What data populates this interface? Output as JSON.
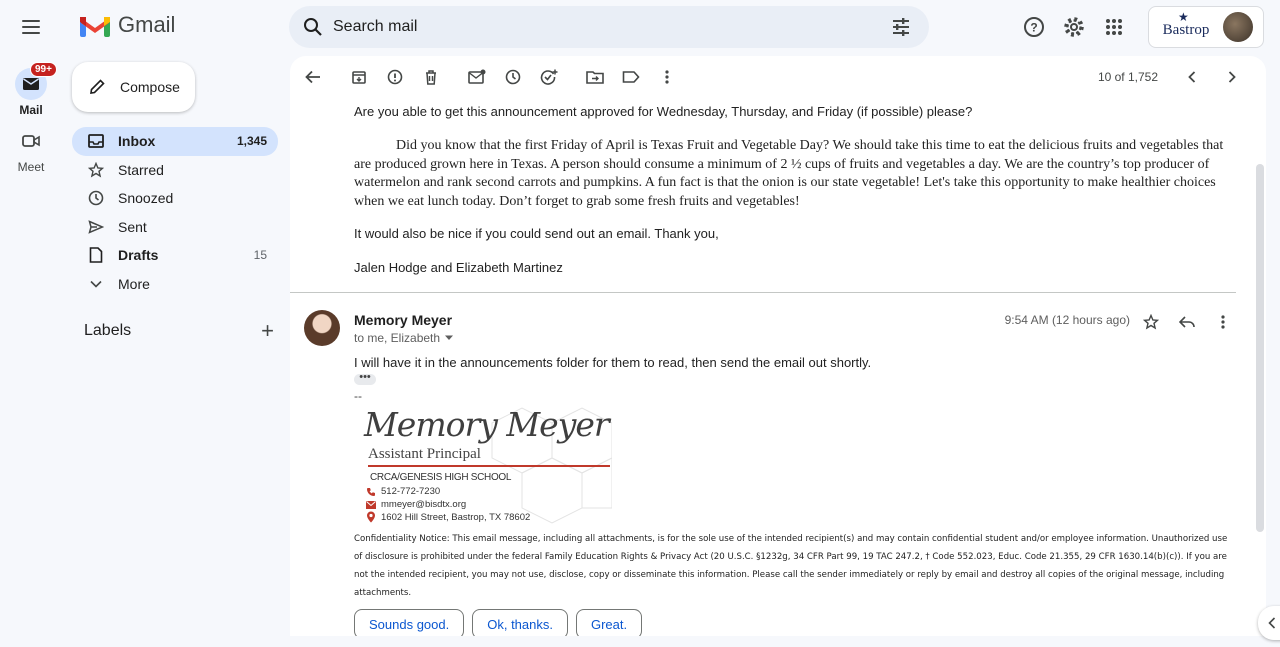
{
  "app": {
    "name": "Gmail"
  },
  "search": {
    "placeholder": "Search mail"
  },
  "rail": {
    "mail_label": "Mail",
    "mail_badge": "99+",
    "meet_label": "Meet"
  },
  "compose": {
    "label": "Compose"
  },
  "nav": [
    {
      "label": "Inbox",
      "count": "1,345",
      "icon": "inbox-icon"
    },
    {
      "label": "Starred",
      "count": "",
      "icon": "star-icon"
    },
    {
      "label": "Snoozed",
      "count": "",
      "icon": "clock-icon"
    },
    {
      "label": "Sent",
      "count": "",
      "icon": "send-icon"
    },
    {
      "label": "Drafts",
      "count": "15",
      "icon": "draft-icon"
    },
    {
      "label": "More",
      "count": "",
      "icon": "chevron-down-icon"
    }
  ],
  "labels": {
    "title": "Labels"
  },
  "pager": {
    "text": "10 of 1,752"
  },
  "email": {
    "line1": "Are you able to get this announcement approved for Wednesday, Thursday, and Friday (if possible) please?",
    "para": "Did you know that the first Friday of April is Texas Fruit and Vegetable Day? We should take this time to eat the delicious fruits and vegetables that are produced grown here in Texas. A person should consume a minimum of 2 ½ cups of fruits and vegetables a day. We are the country’s top producer of watermelon and rank second carrots and pumpkins. A fun fact is that the onion is our state vegetable! Let's take this opportunity to make healthier choices when we eat lunch today. Don’t forget to grab some fresh fruits and vegetables!",
    "line3": "It would also be nice if you could send out an email. Thank you,",
    "line4": "Jalen Hodge and Elizabeth Martinez"
  },
  "reply": {
    "sender": "Memory Meyer",
    "to": "to me, Elizabeth",
    "time": "9:54 AM (12 hours ago)",
    "body": "I will have it in the announcements folder for them to read, then send the email out shortly.",
    "dash": "--",
    "signature": {
      "name": "Memory Meyer",
      "title": "Assistant Principal",
      "school": "CRCA/GENESIS HIGH SCHOOL",
      "phone": "512-772-7230",
      "email": "mmeyer@bisdtx.org",
      "address": "1602 Hill Street, Bastrop, TX 78602"
    },
    "confidentiality": "Confidentiality Notice: This email message, including all attachments, is for the sole use of the intended recipient(s) and may contain confidential student and/or employee information. Unauthorized use of disclosure is prohibited under the federal Family Education Rights & Privacy Act (20 U.S.C. §1232g, 34 CFR Part 99, 19 TAC 247.2, † Code 552.023, Educ. Code 21.355, 29 CFR 1630.14(b)(c)). If you are not the intended recipient, you may not use, disclose, copy or disseminate this information. Please call the sender immediately or reply by email and destroy all copies of the original message, including attachments."
  },
  "smart_replies": [
    "Sounds good.",
    "Ok, thanks.",
    "Great."
  ],
  "account": {
    "org": "Bastrop"
  },
  "colors": {
    "accent": "#0b57d0",
    "active_nav": "#d3e3fd",
    "badge": "#c5221f"
  }
}
